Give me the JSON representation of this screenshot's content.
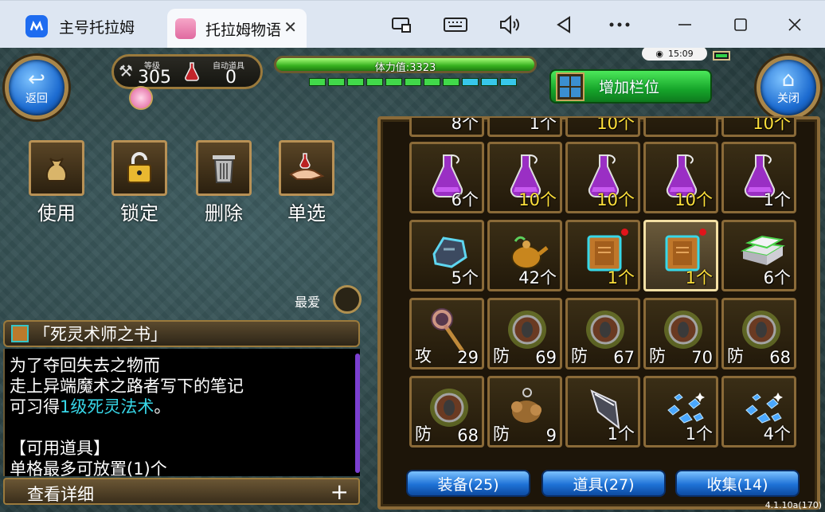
{
  "titlebar": {
    "tabs": [
      {
        "label": "主号托拉姆"
      },
      {
        "label": "托拉姆物语"
      }
    ],
    "icons": [
      "screen-share-icon",
      "keyboard-icon",
      "volume-icon",
      "back-triangle-icon",
      "more-icon",
      "minimize-icon",
      "maximize-icon",
      "close-icon"
    ]
  },
  "hud": {
    "back_label": "返回",
    "close_label": "关闭",
    "level_label": "等级",
    "level_value": "305",
    "auto_item_label": "自动道具",
    "auto_item_value": "0",
    "hp_text": "体力值:3323",
    "hp_fill": 1.0,
    "stamina_segments": 11,
    "cyan_segments": 3,
    "clock": "15:09",
    "add_slot_label": "增加栏位"
  },
  "actions": [
    {
      "label": "使用",
      "icon": "bag-icon"
    },
    {
      "label": "锁定",
      "icon": "lock-icon"
    },
    {
      "label": "删除",
      "icon": "trash-icon"
    },
    {
      "label": "单选",
      "icon": "hand-pick-icon"
    }
  ],
  "favorite_label": "最爱",
  "description": {
    "title": "「死灵术师之书」",
    "line1": "为了夺回失去之物而",
    "line2": "走上异端魔术之路者写下的笔记",
    "line3_pre": "可习得",
    "line3_hl": "1级死灵法术",
    "line3_post": "。",
    "line4": "【可用道具】",
    "line5": "单格最多可放置(1)个",
    "detail_label": "查看详细",
    "detail_plus": "+"
  },
  "inventory": {
    "partial_row": [
      "8个",
      "1个",
      "10个",
      "",
      "10个"
    ],
    "rows": [
      [
        {
          "icon": "potion-icon",
          "count": "6个",
          "yellow": false
        },
        {
          "icon": "potion-icon",
          "count": "10个",
          "yellow": true
        },
        {
          "icon": "potion-icon",
          "count": "10个",
          "yellow": true
        },
        {
          "icon": "potion-icon",
          "count": "10个",
          "yellow": true
        },
        {
          "icon": "potion-icon",
          "count": "1个",
          "yellow": false
        }
      ],
      [
        {
          "icon": "stone-icon",
          "count": "5个",
          "yellow": false
        },
        {
          "icon": "teapot-icon",
          "count": "42个",
          "yellow": false
        },
        {
          "icon": "book-icon",
          "count": "1个",
          "yellow": true,
          "new": true
        },
        {
          "icon": "book-icon",
          "count": "1个",
          "yellow": true,
          "new": true,
          "selected": true
        },
        {
          "icon": "ingot-icon",
          "count": "6个",
          "yellow": false
        }
      ],
      [
        {
          "icon": "staff-icon",
          "tag": "攻",
          "count": "29"
        },
        {
          "icon": "shield-icon",
          "tag": "防",
          "count": "69"
        },
        {
          "icon": "shield-icon",
          "tag": "防",
          "count": "67"
        },
        {
          "icon": "shield-icon",
          "tag": "防",
          "count": "70"
        },
        {
          "icon": "shield-icon",
          "tag": "防",
          "count": "68"
        }
      ],
      [
        {
          "icon": "shield-icon",
          "tag": "防",
          "count": "68"
        },
        {
          "icon": "gear-bundle-icon",
          "tag": "防",
          "count": "9"
        },
        {
          "icon": "arrowhead-icon",
          "count": "1个",
          "yellow": false
        },
        {
          "icon": "crystal-icon",
          "count": "1个",
          "yellow": false
        },
        {
          "icon": "crystal-icon",
          "count": "4个",
          "yellow": false
        }
      ]
    ]
  },
  "bottom_tabs": [
    "装备(25)",
    "道具(27)",
    "收集(14)"
  ],
  "version": "4.1.10a(170)",
  "colors": {
    "accent_green": "#16a52a",
    "blue_button": "#1e72d6",
    "gold_frame": "#8a6a38",
    "highlight_cyan": "#37d7e8",
    "count_yellow": "#ffe03a"
  }
}
